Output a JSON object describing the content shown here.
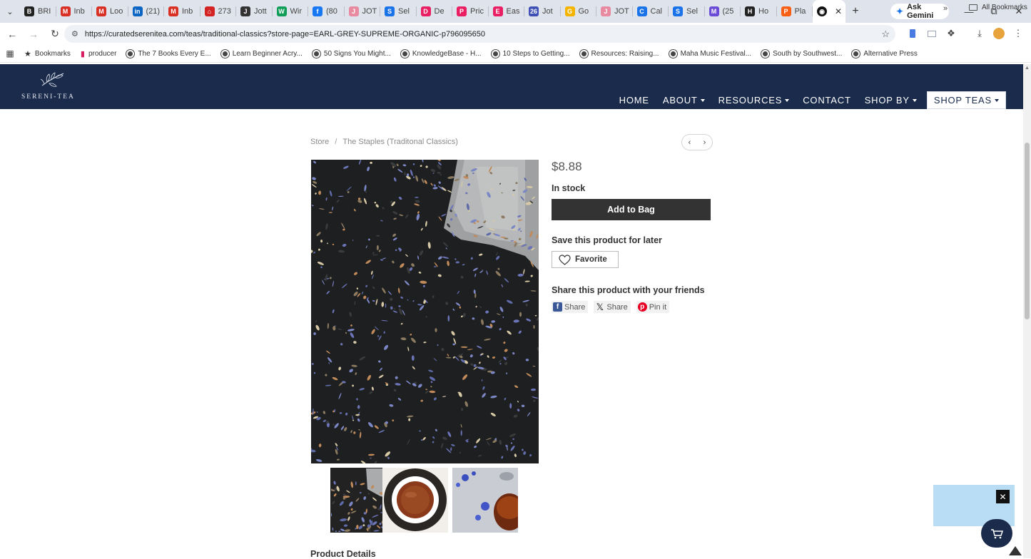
{
  "browser": {
    "tabs": [
      {
        "label": "BRI",
        "color": "#222222",
        "glyph": "B"
      },
      {
        "label": "Inb",
        "color": "#d93025",
        "glyph": "M"
      },
      {
        "label": "Loo",
        "color": "#d93025",
        "glyph": "M"
      },
      {
        "label": "(21)",
        "color": "#0a66c2",
        "glyph": "in"
      },
      {
        "label": "Inb",
        "color": "#d93025",
        "glyph": "M"
      },
      {
        "label": "273",
        "color": "#d32323",
        "glyph": "⌂"
      },
      {
        "label": "Jott",
        "color": "#333333",
        "glyph": "J"
      },
      {
        "label": "Wir",
        "color": "#0f9d58",
        "glyph": "W"
      },
      {
        "label": "(80",
        "color": "#1877f2",
        "glyph": "f"
      },
      {
        "label": "JOT",
        "color": "#e88aa0",
        "glyph": "J"
      },
      {
        "label": "Sel",
        "color": "#1a73e8",
        "glyph": "S"
      },
      {
        "label": "De",
        "color": "#e91e63",
        "glyph": "D"
      },
      {
        "label": "Pric",
        "color": "#e91e63",
        "glyph": "P"
      },
      {
        "label": "Eas",
        "color": "#e91e63",
        "glyph": "E"
      },
      {
        "label": "Jot",
        "color": "#3f51b5",
        "glyph": "26"
      },
      {
        "label": "Go",
        "color": "#f4b400",
        "glyph": "G"
      },
      {
        "label": "JOT",
        "color": "#e88aa0",
        "glyph": "J"
      },
      {
        "label": "Cal",
        "color": "#1a73e8",
        "glyph": "C"
      },
      {
        "label": "Sel",
        "color": "#1a73e8",
        "glyph": "S"
      },
      {
        "label": "(25",
        "color": "#6b4cd6",
        "glyph": "M"
      },
      {
        "label": "Ho",
        "color": "#222222",
        "glyph": "H"
      },
      {
        "label": "Pla",
        "color": "#f96015",
        "glyph": "P"
      }
    ],
    "ask_gemini": "Ask Gemini",
    "url": "https://curatedserenitea.com/teas/traditional-classics?store-page=EARL-GREY-SUPREME-ORGANIC-p796095650",
    "bookmarks": [
      {
        "label": "Bookmarks",
        "icon": "star-icon"
      },
      {
        "label": "producer",
        "icon": "producer-icon"
      },
      {
        "label": "The 7 Books Every E...",
        "icon": "globe-icon"
      },
      {
        "label": "Learn Beginner Acry...",
        "icon": "globe-icon"
      },
      {
        "label": "50 Signs You Might...",
        "icon": "globe-icon"
      },
      {
        "label": "KnowledgeBase - H...",
        "icon": "globe-icon"
      },
      {
        "label": "10 Steps to Getting...",
        "icon": "globe-icon"
      },
      {
        "label": "Resources: Raising...",
        "icon": "globe-icon"
      },
      {
        "label": "Maha Music Festival...",
        "icon": "globe-icon"
      },
      {
        "label": "South by Southwest...",
        "icon": "globe-icon"
      },
      {
        "label": "Alternative Press",
        "icon": "globe-icon"
      }
    ],
    "more_bookmarks": "»",
    "all_bookmarks": "All Bookmarks"
  },
  "site": {
    "logo_text": "SERENI-TEA",
    "nav": [
      {
        "label": "HOME",
        "dropdown": false
      },
      {
        "label": "ABOUT",
        "dropdown": true
      },
      {
        "label": "RESOURCES",
        "dropdown": true
      },
      {
        "label": "CONTACT",
        "dropdown": false
      },
      {
        "label": "SHOP BY",
        "dropdown": true
      },
      {
        "label": "SHOP TEAS",
        "dropdown": true,
        "active": true
      }
    ],
    "colors": {
      "header": "#1a2b4c",
      "button": "#333333"
    }
  },
  "breadcrumb": {
    "store": "Store",
    "separator": "/",
    "category": "The Staples (Traditonal Classics)"
  },
  "product": {
    "price": "$8.88",
    "stock": "In stock",
    "add_to_bag": "Add to Bag",
    "save_heading": "Save this product for later",
    "favorite": "Favorite",
    "share_heading": "Share this product with your friends",
    "shares": [
      {
        "label": "Share",
        "icon": "facebook-icon"
      },
      {
        "label": "Share",
        "icon": "x-icon"
      },
      {
        "label": "Pin it",
        "icon": "pinterest-icon"
      }
    ],
    "details_heading": "Product Details",
    "thumbnail_selected": 1
  },
  "widgets": {
    "close": "✕"
  }
}
